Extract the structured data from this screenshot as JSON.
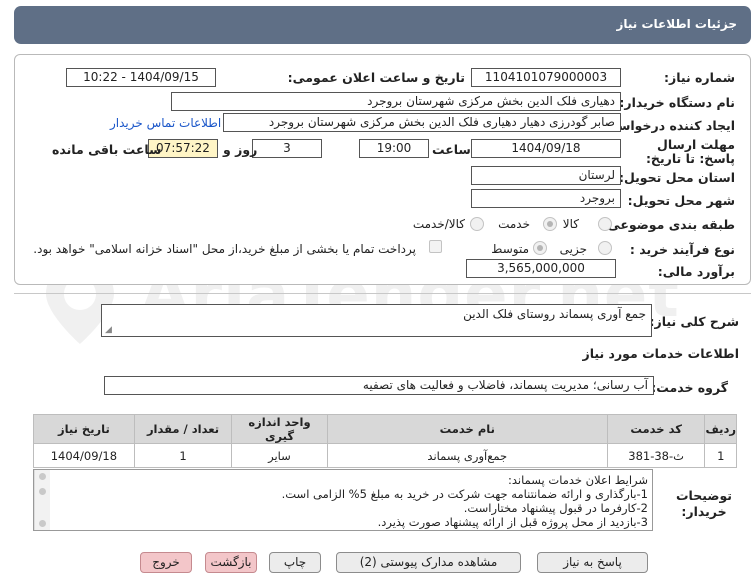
{
  "header": {
    "title": "جزئیات اطلاعات نیاز"
  },
  "form": {
    "need_number_label": "شماره نیاز:",
    "need_number": "1104101079000003",
    "announce_label": "تاریخ و ساعت اعلان عمومی:",
    "announce_value": "1404/09/15 - 10:22",
    "buyer_org_label": "نام دستگاه خریدار:",
    "buyer_org": "دهیاری فلک الدین بخش مرکزی شهرستان بروجرد",
    "creator_label": "ایجاد کننده درخواست:",
    "creator": "صابر گودرزی دهیار دهیاری فلک الدین بخش مرکزی شهرستان بروجرد",
    "contact_link": "اطلاعات تماس خریدار",
    "deadline_label": "مهلت ارسال پاسخ: تا تاریخ:",
    "deadline_date": "1404/09/18",
    "time_label": "ساعت",
    "deadline_time": "19:00",
    "days_value": "3",
    "days_label": "روز و",
    "remaining_time": "07:57:22",
    "remaining_label": "ساعت باقی مانده",
    "province_label": "استان محل تحویل:",
    "province": "لرستان",
    "city_label": "شهر محل تحویل:",
    "city": "بروجرد",
    "category_label": "طبقه بندی موضوعی:",
    "category_options": [
      "کالا",
      "خدمت",
      "کالا/خدمت"
    ],
    "process_label": "نوع فرآیند خرید :",
    "process_options": [
      "جزیی",
      "متوسط"
    ],
    "payment_note": "پرداخت تمام یا بخشی از مبلغ خرید،از محل \"اسناد خزانه اسلامی\" خواهد بود.",
    "budget_label": "برآورد مالی:",
    "budget": "3,565,000,000"
  },
  "description": {
    "label": "شرح کلی نیاز:",
    "value": "جمع آوری پسماند روستای فلک الدین"
  },
  "services": {
    "section_title": "اطلاعات خدمات مورد نیاز",
    "group_label": "گروه خدمت:",
    "group_value": "آب رسانی؛ مدیریت پسماند، فاضلاب و فعالیت های تصفیه",
    "columns": [
      "ردیف",
      "کد خدمت",
      "نام خدمت",
      "واحد اندازه گیری",
      "تعداد / مقدار",
      "تاریخ نیاز"
    ],
    "rows": [
      [
        "1",
        "ث-38-381",
        "جمع‌آوری پسماند",
        "سایر",
        "1",
        "1404/09/18"
      ]
    ]
  },
  "notes": {
    "label": "توضیحات خریدار:",
    "lines": [
      "شرایط اعلان خدمات پسماند:",
      "1-بارگذاری و ارائه ضمانتنامه جهت شرکت در خرید به مبلغ 5% الزامی است.",
      "2-کارفرما در قبول پیشنهاد مختاراست.",
      "3-بازدید از محل پروژه قبل از ارائه پیشنهاد صورت پذیرد."
    ]
  },
  "buttons": {
    "reply": "پاسخ به نیاز",
    "docs": "مشاهده مدارک پیوستی (2)",
    "print": "چاپ",
    "back": "بازگشت",
    "exit": "خروج"
  },
  "watermark": {
    "text": "AriaTender.net"
  }
}
